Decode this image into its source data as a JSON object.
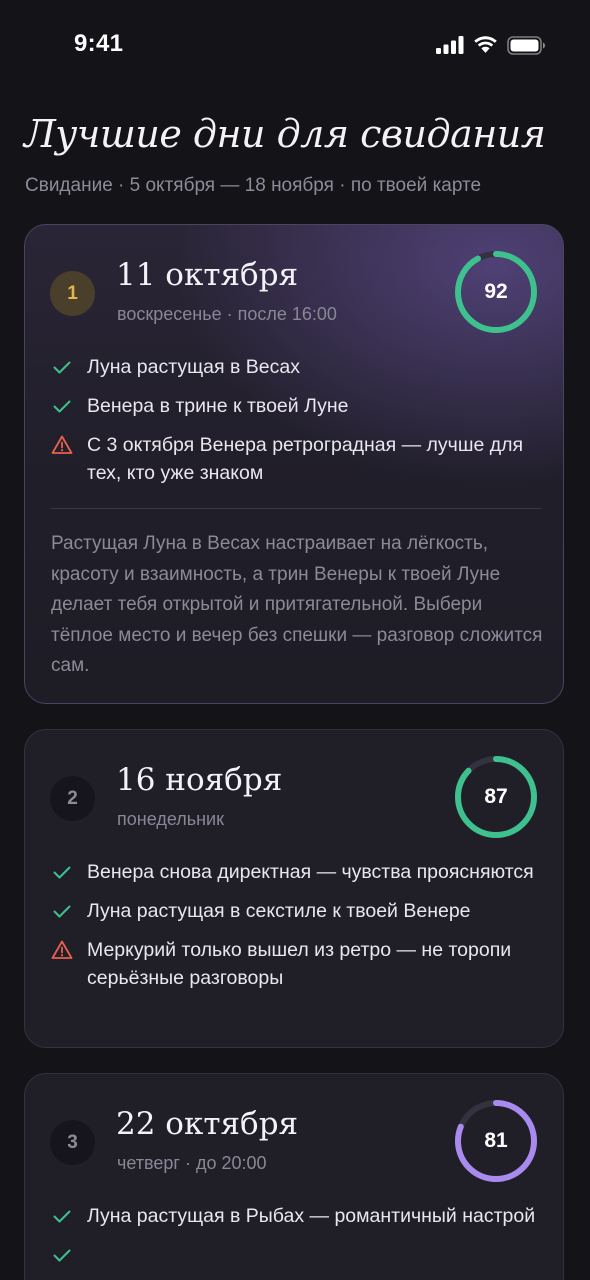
{
  "status_bar": {
    "time": "9:41"
  },
  "header": {
    "title": "Лучшие дни для свидания",
    "subtitle": "Свидание · 5 октября — 18 ноября · по твоей карте"
  },
  "colors": {
    "background": "#141318",
    "positive": "#3FC08F",
    "warning": "#E8614F",
    "gold": "#E6B54E",
    "purple": "#A98BF0"
  },
  "cards": [
    {
      "rank": "1",
      "date": "11 октября",
      "day": "воскресенье · после 16:00",
      "score": "92",
      "score_fraction": 0.92,
      "score_color": "#3FC08F",
      "factors": [
        {
          "icon": "check-icon",
          "text": "Луна растущая в Весах"
        },
        {
          "icon": "check-icon",
          "text": "Венера в трине к твоей Луне"
        },
        {
          "icon": "warning-icon",
          "text": "С 3 октября Венера ретроградная — лучше для тех, кто уже знаком"
        }
      ],
      "description": "Растущая Луна в Весах настраивает на лёгкость, красоту и взаимность, а трин Венеры к твоей Луне делает тебя открытой и притягательной. Выбери тёплое место и вечер без спешки — разговор сложится сам."
    },
    {
      "rank": "2",
      "date": "16 ноября",
      "day": "понедельник",
      "score": "87",
      "score_fraction": 0.87,
      "score_color": "#3FC08F",
      "factors": [
        {
          "icon": "check-icon",
          "text": "Венера снова директная — чувства проясняются"
        },
        {
          "icon": "check-icon",
          "text": "Луна растущая в секстиле к твоей Венере"
        },
        {
          "icon": "warning-icon",
          "text": "Меркурий только вышел из ретро — не торопи серьёзные разговоры"
        }
      ]
    },
    {
      "rank": "3",
      "date": "22 октября",
      "day": "четверг · до 20:00",
      "score": "81",
      "score_fraction": 0.81,
      "score_color": "#A98BF0",
      "factors": [
        {
          "icon": "check-icon",
          "text": "Луна растущая в Рыбах — романтичный настрой"
        }
      ]
    }
  ]
}
